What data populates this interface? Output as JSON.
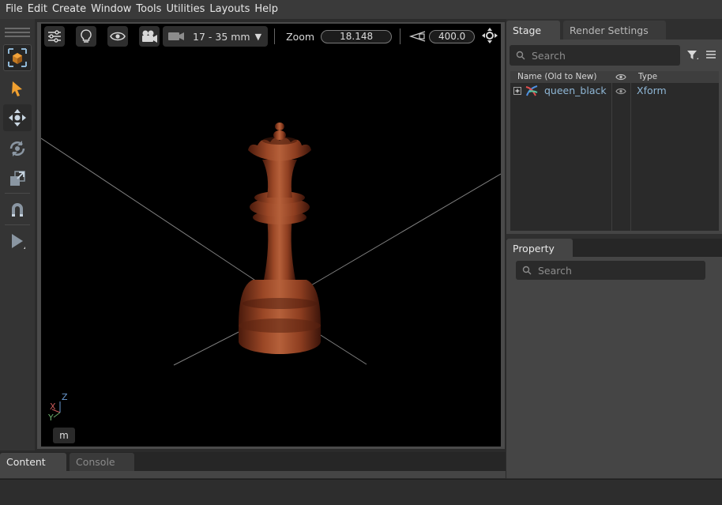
{
  "menu": [
    "File",
    "Edit",
    "Create",
    "Window",
    "Tools",
    "Utilities",
    "Layouts",
    "Help"
  ],
  "toolbar": {
    "tools": [
      {
        "icon": "select-box-icon",
        "state": "active"
      },
      {
        "icon": "pointer-icon"
      },
      {
        "icon": "move-icon",
        "state": "selected"
      },
      {
        "icon": "rotate-icon"
      },
      {
        "icon": "scale-icon"
      },
      {
        "icon": "snap-magnet-icon"
      },
      {
        "icon": "play-icon"
      }
    ]
  },
  "viewport": {
    "camera_lens": "17 - 35 mm",
    "zoom_label": "Zoom",
    "zoom_value": "18.148",
    "fov_value": "400.0",
    "axis_labels": {
      "z": "Z",
      "x": "X",
      "y": "Y"
    },
    "units_button": "m",
    "object_name": "queen_black"
  },
  "stage": {
    "tabs": [
      "Stage",
      "Render Settings"
    ],
    "active_tab": "Stage",
    "search_placeholder": "Search",
    "columns": {
      "name": "Name (Old to New)",
      "type": "Type"
    },
    "rows": [
      {
        "name": "queen_black",
        "type": "Xform",
        "visible": true
      }
    ]
  },
  "property": {
    "tab": "Property",
    "search_placeholder": "Search"
  },
  "bottom": {
    "tabs": [
      "Content",
      "Console"
    ],
    "active_tab": "Content"
  },
  "colors": {
    "accent_orange": "#f0a030",
    "tree_text": "#8fb7d6",
    "wood": "#8b3a1e"
  }
}
